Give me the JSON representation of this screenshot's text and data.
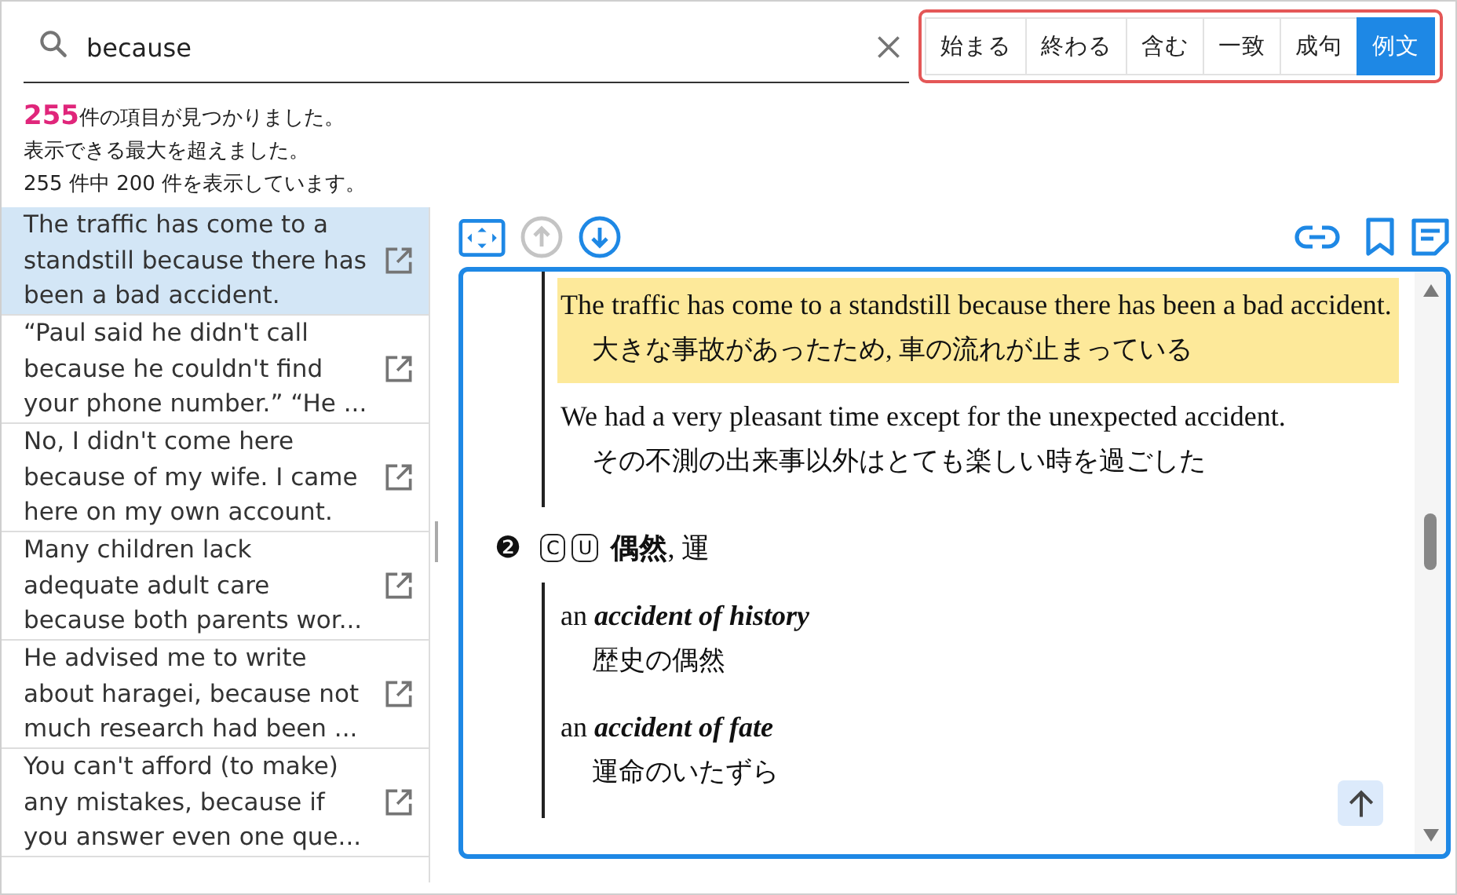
{
  "search": {
    "value": "because"
  },
  "match_modes": [
    {
      "label": "始まる",
      "selected": false
    },
    {
      "label": "終わる",
      "selected": false
    },
    {
      "label": "含む",
      "selected": false
    },
    {
      "label": "一致",
      "selected": false
    },
    {
      "label": "成句",
      "selected": false
    },
    {
      "label": "例文",
      "selected": true
    }
  ],
  "result_info": {
    "count": "255",
    "count_suffix": "件の項目が見つかりました。",
    "lines": [
      "表示できる最大を超えました。",
      "255 件中 200 件を表示しています。"
    ]
  },
  "results": [
    {
      "text": "The traffic has come to a standstill because there has been a bad accident.",
      "selected": true
    },
    {
      "text": "“Paul said he didn't call because he couldn't find your phone number.” “He ...",
      "selected": false
    },
    {
      "text": "No, I didn't come here because of my wife. I came here on my own account.",
      "selected": false
    },
    {
      "text": "Many children lack adequate adult care because both parents wor...",
      "selected": false
    },
    {
      "text": "He advised me to write about haragei, because not much research had been ...",
      "selected": false
    },
    {
      "text": "You can't afford (to make) any mistakes, because if you answer even one que...",
      "selected": false
    }
  ],
  "nav_buttons": [
    {
      "kind": "up",
      "disabled": true
    },
    {
      "kind": "down",
      "disabled": false
    }
  ],
  "entry": {
    "examples": [
      {
        "en": "The traffic has come to a standstill because there has been a bad accident.",
        "ja": "大きな事故があったため, 車の流れが止まっている",
        "selected": true
      },
      {
        "en": "We had a very pleasant time except for the unexpected accident.",
        "ja": "その不測の出来事以外はとても楽しい時を過ごした",
        "selected": false
      }
    ],
    "sense": {
      "number": "❷",
      "labels": [
        "C",
        "U"
      ],
      "gloss": "**偶然**, 運",
      "examples": [
        {
          "prefix": "an",
          "phrase": "accident of history",
          "ja": "歴史の偶然"
        },
        {
          "prefix": "an",
          "phrase": "accident of fate",
          "ja": "運命のいたずら"
        }
      ]
    }
  }
}
